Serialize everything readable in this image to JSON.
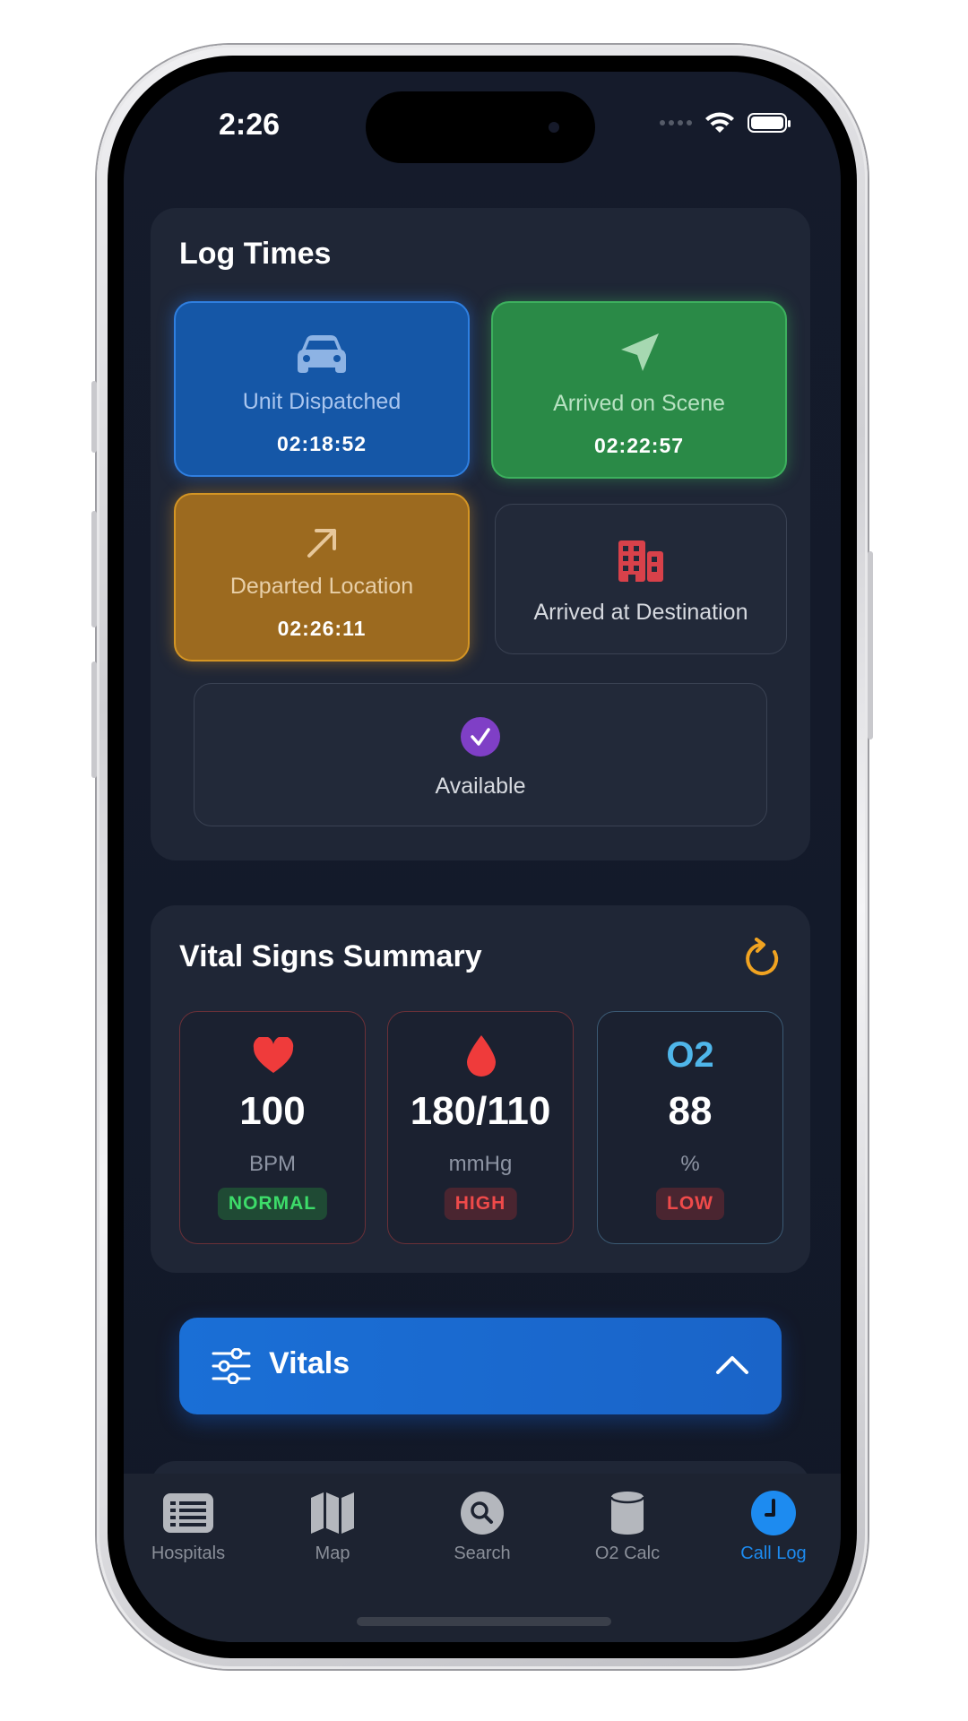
{
  "status_bar": {
    "time": "2:26"
  },
  "log_times": {
    "title": "Log Times",
    "tiles": [
      {
        "label": "Unit Dispatched",
        "time": "02:18:52",
        "icon": "car-icon",
        "color": "#1557a7"
      },
      {
        "label": "Arrived on Scene",
        "time": "02:22:57",
        "icon": "location-arrow-icon",
        "color": "#2a8a47"
      },
      {
        "label": "Departed Location",
        "time": "02:26:11",
        "icon": "arrow-up-right-icon",
        "color": "#9c6a1f"
      },
      {
        "label": "Arrived at Destination",
        "time": "",
        "icon": "hospital-building-icon",
        "color": "#d8414a"
      },
      {
        "label": "Available",
        "time": "",
        "icon": "checkmark-circle-icon",
        "color": "#7f3fc6"
      }
    ]
  },
  "vital_summary": {
    "title": "Vital Signs Summary",
    "refresh_icon": "refresh-icon",
    "items": [
      {
        "icon": "heart-icon",
        "value": "100",
        "unit": "BPM",
        "status": "NORMAL",
        "status_color": "#3ddc6a",
        "border": "#6b3038"
      },
      {
        "icon": "blood-drop-icon",
        "value": "180/110",
        "unit": "mmHg",
        "status": "HIGH",
        "status_color": "#ef4a4a",
        "border": "#6b3038"
      },
      {
        "icon_text": "O2",
        "value": "88",
        "unit": "%",
        "status": "LOW",
        "status_color": "#ef4a4a",
        "border": "#3b5a74"
      }
    ]
  },
  "vitals_button": {
    "label": "Vitals",
    "icon": "sliders-icon",
    "chevron": "chevron-up-icon"
  },
  "tab_bar": {
    "items": [
      {
        "label": "Hospitals",
        "icon": "list-icon",
        "active": false
      },
      {
        "label": "Map",
        "icon": "map-icon",
        "active": false
      },
      {
        "label": "Search",
        "icon": "search-icon",
        "active": false
      },
      {
        "label": "O2 Calc",
        "icon": "cylinder-icon",
        "active": false
      },
      {
        "label": "Call Log",
        "icon": "clock-icon",
        "active": true
      }
    ],
    "active_color": "#1d8bf0"
  }
}
